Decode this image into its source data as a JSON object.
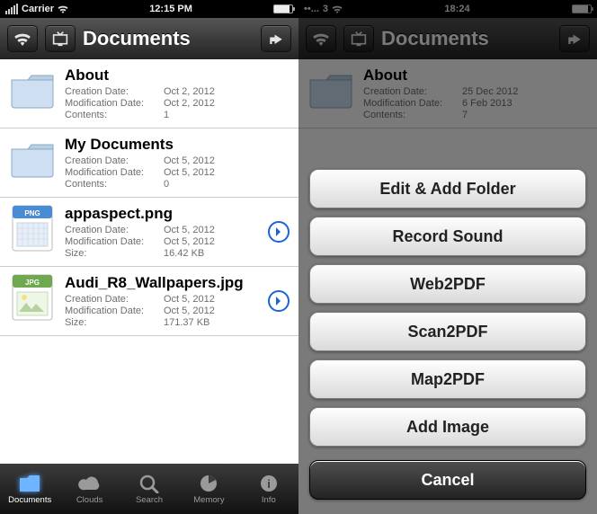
{
  "left": {
    "status": {
      "carrier": "Carrier",
      "time": "12:15 PM"
    },
    "title": "Documents",
    "rows": [
      {
        "kind": "folder",
        "name": "About",
        "created": "Oct 2, 2012",
        "modified": "Oct 2, 2012",
        "contents": "1"
      },
      {
        "kind": "folder",
        "name": "My Documents",
        "created": "Oct 5, 2012",
        "modified": "Oct 5, 2012",
        "contents": "0"
      },
      {
        "kind": "png",
        "name": "appaspect.png",
        "created": "Oct 5, 2012",
        "modified": "Oct 5, 2012",
        "size": "16.42 KB"
      },
      {
        "kind": "jpg",
        "name": "Audi_R8_Wallpapers.jpg",
        "created": "Oct 5, 2012",
        "modified": "Oct 5, 2012",
        "size": "171.37 KB"
      }
    ],
    "labels": {
      "created": "Creation Date:",
      "modified": "Modification Date:",
      "contents": "Contents:",
      "size": "Size:"
    },
    "tabs": [
      {
        "label": "Documents",
        "active": true
      },
      {
        "label": "Clouds",
        "active": false
      },
      {
        "label": "Search",
        "active": false
      },
      {
        "label": "Memory",
        "active": false
      },
      {
        "label": "Info",
        "active": false
      }
    ]
  },
  "right": {
    "status": {
      "carrier_dots": "••...",
      "carrier": "3",
      "time": "18:24"
    },
    "title": "Documents",
    "preview": {
      "name": "About",
      "created": "25 Dec 2012",
      "modified": "6 Feb 2013",
      "contents": "7"
    },
    "labels": {
      "created": "Creation Date:",
      "modified": "Modification Date:",
      "contents": "Contents:"
    },
    "sheet": {
      "buttons": [
        "Edit & Add Folder",
        "Record Sound",
        "Web2PDF",
        "Scan2PDF",
        "Map2PDF",
        "Add Image"
      ],
      "cancel": "Cancel"
    }
  }
}
